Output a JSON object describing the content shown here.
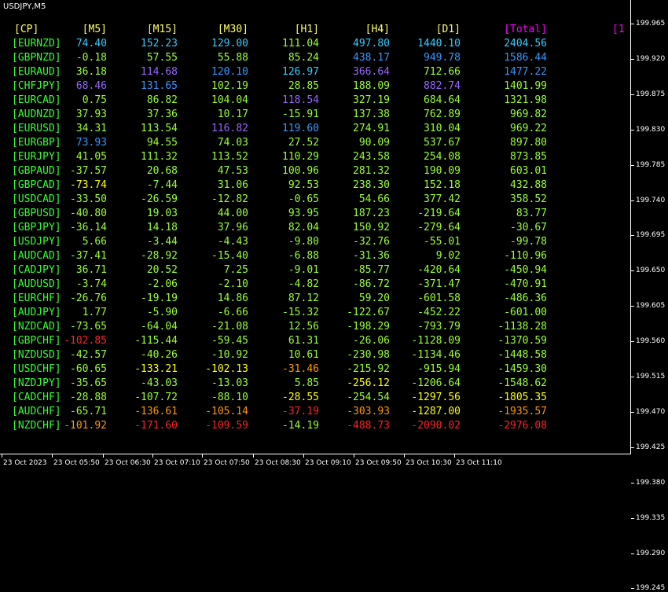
{
  "window": {
    "symbol": "USDJPY,M5"
  },
  "colors": {
    "header_yellow": "#ffff66",
    "header_magenta": "#ff00ff",
    "symbol_green": "#33ff33",
    "cyan": "#33ccff",
    "blue": "#3399ff",
    "purple": "#9966ff",
    "lime": "#99ff33",
    "yellow": "#ffff00",
    "orange": "#ff9900",
    "red": "#ff2222"
  },
  "table": {
    "headers": [
      "[CP]",
      "[M5]",
      "[M15]",
      "[M30]",
      "[H1]",
      "[H4]",
      "[D1]",
      "[Total]",
      "[1"
    ],
    "header_colors": [
      "header_yellow",
      "header_yellow",
      "header_yellow",
      "header_yellow",
      "header_yellow",
      "header_yellow",
      "header_yellow",
      "header_magenta",
      "header_magenta"
    ],
    "rows": [
      {
        "pair": "[EURNZD]",
        "values": [
          "74.40",
          "152.23",
          "129.00",
          "111.04",
          "497.80",
          "1440.10",
          "2404.56"
        ],
        "colors": [
          "cyan",
          "cyan",
          "cyan",
          "lime",
          "cyan",
          "cyan",
          "cyan"
        ]
      },
      {
        "pair": "[GBPNZD]",
        "values": [
          "-0.18",
          "57.55",
          "55.88",
          "85.24",
          "438.17",
          "949.78",
          "1586.44"
        ],
        "colors": [
          "lime",
          "lime",
          "lime",
          "lime",
          "blue",
          "blue",
          "blue"
        ]
      },
      {
        "pair": "[EURAUD]",
        "values": [
          "36.18",
          "114.68",
          "120.10",
          "126.97",
          "366.64",
          "712.66",
          "1477.22"
        ],
        "colors": [
          "lime",
          "purple",
          "blue",
          "cyan",
          "purple",
          "lime",
          "blue"
        ]
      },
      {
        "pair": "[CHFJPY]",
        "values": [
          "68.46",
          "131.65",
          "102.19",
          "28.85",
          "188.09",
          "882.74",
          "1401.99"
        ],
        "colors": [
          "purple",
          "blue",
          "lime",
          "lime",
          "lime",
          "purple",
          "lime"
        ]
      },
      {
        "pair": "[EURCAD]",
        "values": [
          "0.75",
          "86.82",
          "104.04",
          "118.54",
          "327.19",
          "684.64",
          "1321.98"
        ],
        "colors": [
          "lime",
          "lime",
          "lime",
          "purple",
          "lime",
          "lime",
          "lime"
        ]
      },
      {
        "pair": "[AUDNZD]",
        "values": [
          "37.93",
          "37.36",
          "10.17",
          "-15.91",
          "137.38",
          "762.89",
          "969.82"
        ],
        "colors": [
          "lime",
          "lime",
          "lime",
          "lime",
          "lime",
          "lime",
          "lime"
        ]
      },
      {
        "pair": "[EURUSD]",
        "values": [
          "34.31",
          "113.54",
          "116.82",
          "119.60",
          "274.91",
          "310.04",
          "969.22"
        ],
        "colors": [
          "lime",
          "lime",
          "purple",
          "blue",
          "lime",
          "lime",
          "lime"
        ]
      },
      {
        "pair": "[EURGBP]",
        "values": [
          "73.93",
          "94.55",
          "74.03",
          "27.52",
          "90.09",
          "537.67",
          "897.80"
        ],
        "colors": [
          "blue",
          "lime",
          "lime",
          "lime",
          "lime",
          "lime",
          "lime"
        ]
      },
      {
        "pair": "[EURJPY]",
        "values": [
          "41.05",
          "111.32",
          "113.52",
          "110.29",
          "243.58",
          "254.08",
          "873.85"
        ],
        "colors": [
          "lime",
          "lime",
          "lime",
          "lime",
          "lime",
          "lime",
          "lime"
        ]
      },
      {
        "pair": "[GBPAUD]",
        "values": [
          "-37.57",
          "20.68",
          "47.53",
          "100.96",
          "281.32",
          "190.09",
          "603.01"
        ],
        "colors": [
          "lime",
          "lime",
          "lime",
          "lime",
          "lime",
          "lime",
          "lime"
        ]
      },
      {
        "pair": "[GBPCAD]",
        "values": [
          "-73.74",
          "-7.44",
          "31.06",
          "92.53",
          "238.30",
          "152.18",
          "432.88"
        ],
        "colors": [
          "yellow",
          "lime",
          "lime",
          "lime",
          "lime",
          "lime",
          "lime"
        ]
      },
      {
        "pair": "[USDCAD]",
        "values": [
          "-33.50",
          "-26.59",
          "-12.82",
          "-0.65",
          "54.66",
          "377.42",
          "358.52"
        ],
        "colors": [
          "lime",
          "lime",
          "lime",
          "lime",
          "lime",
          "lime",
          "lime"
        ]
      },
      {
        "pair": "[GBPUSD]",
        "values": [
          "-40.80",
          "19.03",
          "44.00",
          "93.95",
          "187.23",
          "-219.64",
          "83.77"
        ],
        "colors": [
          "lime",
          "lime",
          "lime",
          "lime",
          "lime",
          "lime",
          "lime"
        ]
      },
      {
        "pair": "[GBPJPY]",
        "values": [
          "-36.14",
          "14.18",
          "37.96",
          "82.04",
          "150.92",
          "-279.64",
          "-30.67"
        ],
        "colors": [
          "lime",
          "lime",
          "lime",
          "lime",
          "lime",
          "lime",
          "lime"
        ]
      },
      {
        "pair": "[USDJPY]",
        "values": [
          "5.66",
          "-3.44",
          "-4.43",
          "-9.80",
          "-32.76",
          "-55.01",
          "-99.78"
        ],
        "colors": [
          "lime",
          "lime",
          "lime",
          "lime",
          "lime",
          "lime",
          "lime"
        ]
      },
      {
        "pair": "[AUDCAD]",
        "values": [
          "-37.41",
          "-28.92",
          "-15.40",
          "-6.88",
          "-31.36",
          "9.02",
          "-110.96"
        ],
        "colors": [
          "lime",
          "lime",
          "lime",
          "lime",
          "lime",
          "lime",
          "lime"
        ]
      },
      {
        "pair": "[CADJPY]",
        "values": [
          "36.71",
          "20.52",
          "7.25",
          "-9.01",
          "-85.77",
          "-420.64",
          "-450.94"
        ],
        "colors": [
          "lime",
          "lime",
          "lime",
          "lime",
          "lime",
          "lime",
          "lime"
        ]
      },
      {
        "pair": "[AUDUSD]",
        "values": [
          "-3.74",
          "-2.06",
          "-2.10",
          "-4.82",
          "-86.72",
          "-371.47",
          "-470.91"
        ],
        "colors": [
          "lime",
          "lime",
          "lime",
          "lime",
          "lime",
          "lime",
          "lime"
        ]
      },
      {
        "pair": "[EURCHF]",
        "values": [
          "-26.76",
          "-19.19",
          "14.86",
          "87.12",
          "59.20",
          "-601.58",
          "-486.36"
        ],
        "colors": [
          "lime",
          "lime",
          "lime",
          "lime",
          "lime",
          "lime",
          "lime"
        ]
      },
      {
        "pair": "[AUDJPY]",
        "values": [
          "1.77",
          "-5.90",
          "-6.66",
          "-15.32",
          "-122.67",
          "-452.22",
          "-601.00"
        ],
        "colors": [
          "lime",
          "lime",
          "lime",
          "lime",
          "lime",
          "lime",
          "lime"
        ]
      },
      {
        "pair": "[NZDCAD]",
        "values": [
          "-73.65",
          "-64.04",
          "-21.08",
          "12.56",
          "-198.29",
          "-793.79",
          "-1138.28"
        ],
        "colors": [
          "lime",
          "lime",
          "lime",
          "lime",
          "lime",
          "lime",
          "lime"
        ]
      },
      {
        "pair": "[GBPCHF]",
        "values": [
          "-102.85",
          "-115.44",
          "-59.45",
          "61.31",
          "-26.06",
          "-1128.09",
          "-1370.59"
        ],
        "colors": [
          "red",
          "lime",
          "lime",
          "lime",
          "lime",
          "lime",
          "lime"
        ]
      },
      {
        "pair": "[NZDUSD]",
        "values": [
          "-42.57",
          "-40.26",
          "-10.92",
          "10.61",
          "-230.98",
          "-1134.46",
          "-1448.58"
        ],
        "colors": [
          "lime",
          "lime",
          "lime",
          "lime",
          "lime",
          "lime",
          "lime"
        ]
      },
      {
        "pair": "[USDCHF]",
        "values": [
          "-60.65",
          "-133.21",
          "-102.13",
          "-31.46",
          "-215.92",
          "-915.94",
          "-1459.30"
        ],
        "colors": [
          "lime",
          "yellow",
          "yellow",
          "orange",
          "lime",
          "lime",
          "lime"
        ]
      },
      {
        "pair": "[NZDJPY]",
        "values": [
          "-35.65",
          "-43.03",
          "-13.03",
          "5.85",
          "-256.12",
          "-1206.64",
          "-1548.62"
        ],
        "colors": [
          "lime",
          "lime",
          "lime",
          "lime",
          "yellow",
          "lime",
          "lime"
        ]
      },
      {
        "pair": "[CADCHF]",
        "values": [
          "-28.88",
          "-107.72",
          "-88.10",
          "-28.55",
          "-254.54",
          "-1297.56",
          "-1805.35"
        ],
        "colors": [
          "lime",
          "lime",
          "lime",
          "yellow",
          "lime",
          "yellow",
          "yellow"
        ]
      },
      {
        "pair": "[AUDCHF]",
        "values": [
          "-65.71",
          "-136.61",
          "-105.14",
          "-37.19",
          "-303.93",
          "-1287.00",
          "-1935.57"
        ],
        "colors": [
          "lime",
          "orange",
          "orange",
          "red",
          "orange",
          "yellow",
          "orange"
        ]
      },
      {
        "pair": "[NZDCHF]",
        "values": [
          "-101.92",
          "-171.60",
          "-109.59",
          "-14.19",
          "-488.73",
          "-2090.02",
          "-2976.08"
        ],
        "colors": [
          "orange",
          "red",
          "red",
          "lime",
          "red",
          "red",
          "red"
        ]
      }
    ]
  },
  "price_axis": [
    "199.965",
    "199.920",
    "199.875",
    "199.830",
    "199.785",
    "199.740",
    "199.695",
    "199.650",
    "199.605",
    "199.560",
    "199.515",
    "199.470",
    "199.425",
    "199.380",
    "199.335",
    "199.290",
    "199.245"
  ],
  "time_axis": [
    "23 Oct 2023",
    "23 Oct 05:50",
    "23 Oct 06:30",
    "23 Oct 07:10",
    "23 Oct 07:50",
    "23 Oct 08:30",
    "23 Oct 09:10",
    "23 Oct 09:50",
    "23 Oct 10:30",
    "23 Oct 11:10"
  ]
}
